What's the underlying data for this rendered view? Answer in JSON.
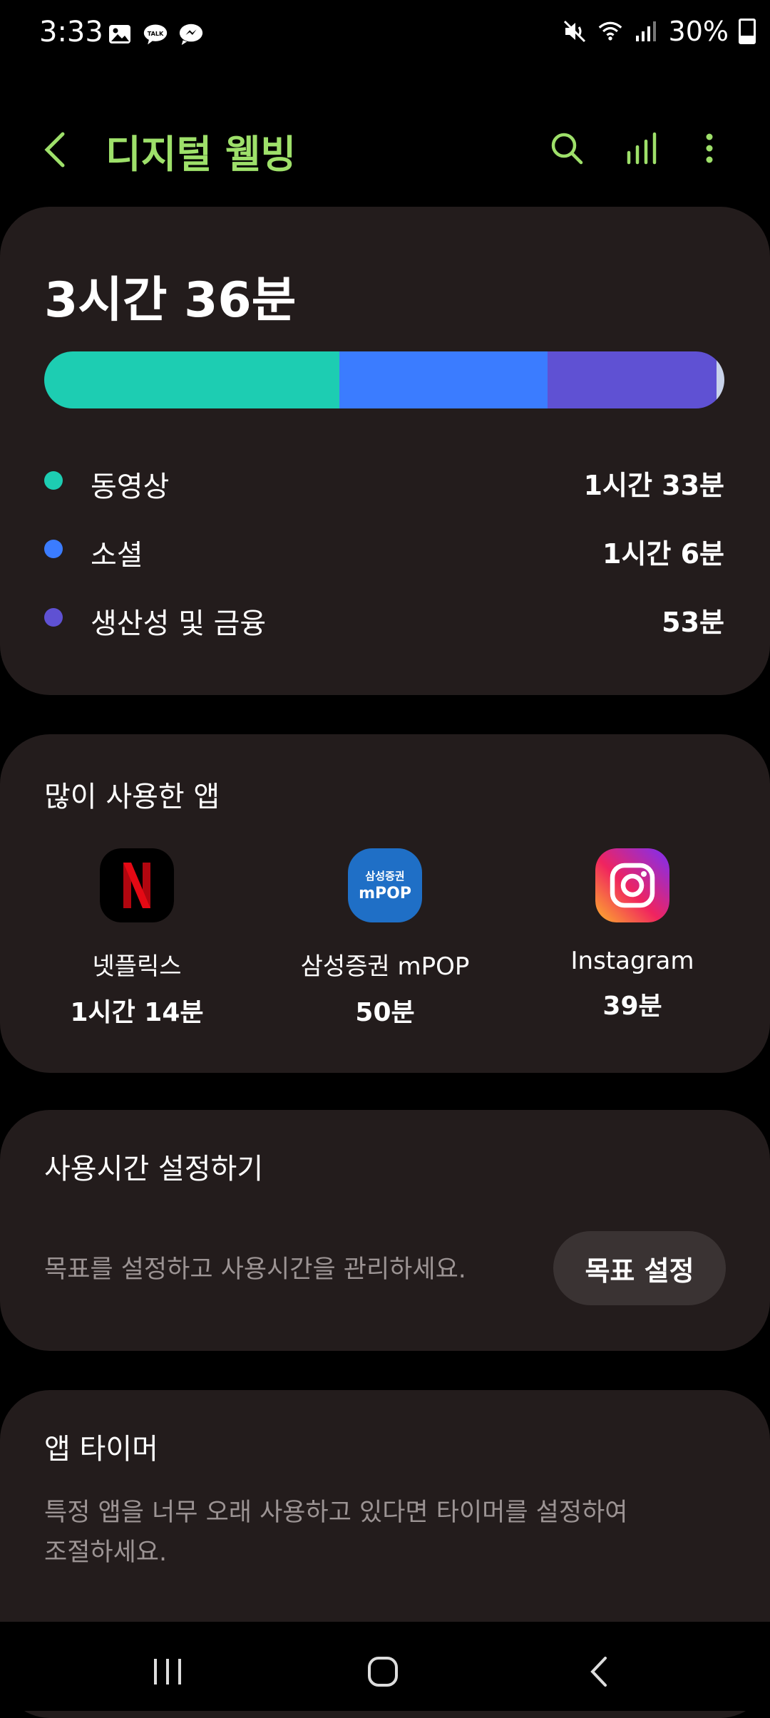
{
  "status_bar": {
    "time": "3:33",
    "battery": "30%",
    "left_icons": [
      "gallery-icon",
      "kakaotalk-icon",
      "messenger-icon"
    ],
    "right_icons": [
      "mute-icon",
      "wifi-icon",
      "signal-icon",
      "battery-icon"
    ]
  },
  "header": {
    "title": "디지털 웰빙",
    "accent_color": "#9ee06a"
  },
  "usage": {
    "total": "3시간 36분",
    "categories": [
      {
        "label": "동영상",
        "value": "1시간 33분",
        "color": "#1dcdb2",
        "fraction": 0.434
      },
      {
        "label": "소셜",
        "value": "1시간 6분",
        "color": "#3b7cff",
        "fraction": 0.306
      },
      {
        "label": "생산성 및 금융",
        "value": "53분",
        "color": "#5f51d3",
        "fraction": 0.248
      },
      {
        "label": "",
        "value": "",
        "color": "#c9d3ea",
        "fraction": 0.012
      }
    ]
  },
  "top_apps": {
    "title": "많이 사용한 앱",
    "apps": [
      {
        "name": "넷플릭스",
        "time": "1시간 14분",
        "icon": "netflix-icon"
      },
      {
        "name": "삼성증권 mPOP",
        "time": "50분",
        "icon": "mpop-icon",
        "icon_text_top": "삼성증권",
        "icon_text_bottom": "mPOP"
      },
      {
        "name": "Instagram",
        "time": "39분",
        "icon": "instagram-icon"
      }
    ]
  },
  "goal": {
    "title": "사용시간 설정하기",
    "description": "목표를 설정하고 사용시간을 관리하세요.",
    "button": "목표 설정"
  },
  "app_timer": {
    "title": "앱 타이머",
    "description_line1": "특정 앱을 너무 오래 사용하고 있다면 타이머를 설정하여",
    "description_line2": "조절하세요."
  }
}
